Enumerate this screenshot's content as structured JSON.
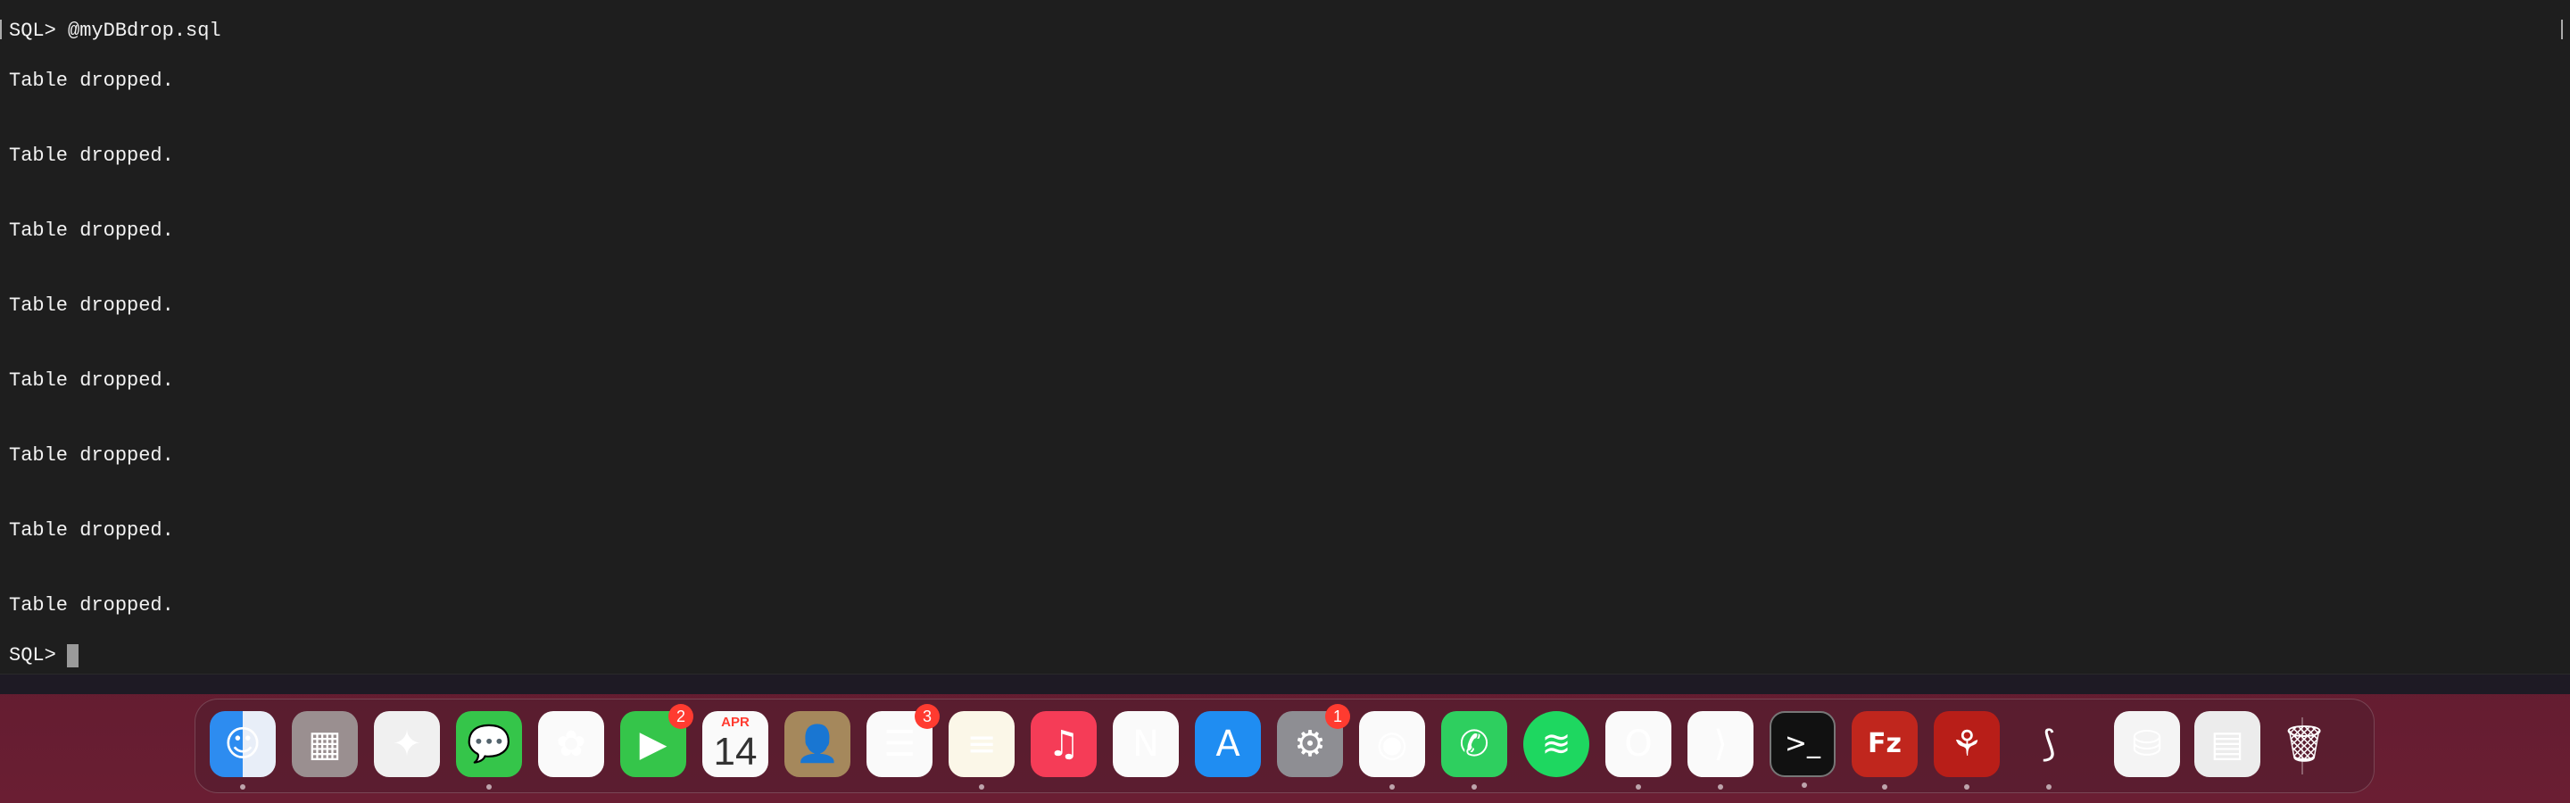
{
  "terminal": {
    "prompt_command": "SQL> @myDBdrop.sql",
    "lines": [
      "Table dropped.",
      "Table dropped.",
      "Table dropped.",
      "Table dropped.",
      "Table dropped.",
      "Table dropped.",
      "Table dropped.",
      "Table dropped."
    ],
    "final_prompt": "SQL>"
  },
  "dock": {
    "items": [
      {
        "name": "finder",
        "icon": "finder-icon",
        "glyph": "☺",
        "running": true
      },
      {
        "name": "launchpad",
        "icon": "launchpad-icon",
        "glyph": "▦",
        "running": false
      },
      {
        "name": "safari",
        "icon": "safari-icon",
        "glyph": "✦",
        "running": false
      },
      {
        "name": "messages",
        "icon": "messages-icon",
        "glyph": "💬",
        "running": true
      },
      {
        "name": "photos",
        "icon": "photos-icon",
        "glyph": "✿",
        "running": false
      },
      {
        "name": "facetime",
        "icon": "facetime-icon",
        "glyph": "▶",
        "running": false,
        "badge": "2"
      },
      {
        "name": "calendar",
        "icon": "calendar-icon",
        "month": "APR",
        "day": "14",
        "running": false
      },
      {
        "name": "contacts",
        "icon": "contacts-icon",
        "glyph": "👤",
        "running": false
      },
      {
        "name": "reminders",
        "icon": "reminders-icon",
        "glyph": "☰",
        "running": false,
        "badge": "3"
      },
      {
        "name": "notes",
        "icon": "notes-icon",
        "glyph": "≡",
        "running": true
      },
      {
        "name": "music",
        "icon": "music-icon",
        "glyph": "♫",
        "running": false
      },
      {
        "name": "news",
        "icon": "news-icon",
        "glyph": "N",
        "running": false
      },
      {
        "name": "app-store",
        "icon": "app-store-icon",
        "glyph": "A",
        "running": false
      },
      {
        "name": "system-settings",
        "icon": "settings-gear-icon",
        "glyph": "⚙",
        "running": false,
        "badge": "1"
      },
      {
        "name": "chrome",
        "icon": "chrome-icon",
        "glyph": "◉",
        "running": true
      },
      {
        "name": "whatsapp",
        "icon": "whatsapp-icon",
        "glyph": "✆",
        "running": true
      },
      {
        "name": "spotify",
        "icon": "spotify-icon",
        "glyph": "≋",
        "running": false
      },
      {
        "name": "outlook",
        "icon": "outlook-icon",
        "glyph": "O",
        "running": true
      },
      {
        "name": "vscode",
        "icon": "vscode-icon",
        "glyph": "⟩",
        "running": true
      },
      {
        "name": "terminal",
        "icon": "terminal-icon",
        "glyph": ">_",
        "running": true
      },
      {
        "name": "filezilla",
        "icon": "filezilla-icon",
        "glyph": "Fz",
        "running": true
      },
      {
        "name": "acrobat",
        "icon": "acrobat-icon",
        "glyph": "⚘",
        "running": true
      },
      {
        "name": "sqldeveloper",
        "icon": "sql-developer-icon",
        "glyph": "⟆",
        "running": true
      },
      {
        "name": "sql-file",
        "icon": "sql-file-icon",
        "glyph": "⛁",
        "running": false
      },
      {
        "name": "filezilla-document",
        "icon": "filezilla-document-icon",
        "glyph": "▤",
        "running": false
      },
      {
        "name": "trash",
        "icon": "trash-icon",
        "glyph": "🗑",
        "running": false
      }
    ]
  },
  "colors": {
    "terminal_bg": "#1e1e1e",
    "terminal_text": "#f2f2f2",
    "badge": "#ff3b30",
    "wallpaper": "#5a1a2c"
  }
}
